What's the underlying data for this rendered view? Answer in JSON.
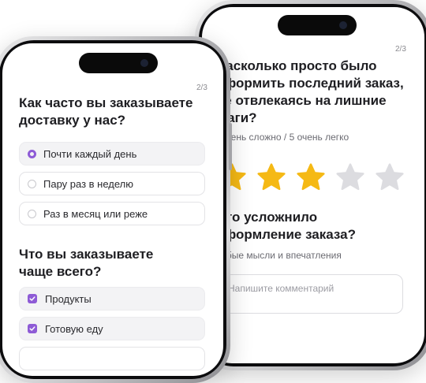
{
  "back_screen": {
    "counter": "2/3",
    "question_lines": [
      "Насколько просто было",
      "оформить последний заказ,",
      "не отвлекаясь на лишние",
      "шаги?"
    ],
    "scale_hint": "1 очень сложно / 5 очень легко",
    "rating": {
      "value": 3,
      "max": 5,
      "filled_color": "#f5b915",
      "empty_color": "#dcdce0"
    },
    "question2_lines": [
      "Что усложнило",
      "оформление заказа?"
    ],
    "question2_hint": "Любые мысли и впечатления",
    "comment_placeholder": "Напишите комментарий"
  },
  "front_screen": {
    "counter": "2/3",
    "question1_lines": [
      "Как часто вы заказываете",
      "доставку у нас?"
    ],
    "options": [
      {
        "label": "Почти каждый день",
        "selected": true
      },
      {
        "label": "Пару раз в неделю",
        "selected": false
      },
      {
        "label": "Раз в месяц или реже",
        "selected": false
      }
    ],
    "question2_lines": [
      "Что вы заказываете",
      "чаще всего?"
    ],
    "checkbox_options": [
      {
        "label": "Продукты",
        "checked": true
      },
      {
        "label": "Готовую еду",
        "checked": true
      }
    ]
  },
  "accent_color": "#8e5bd6"
}
